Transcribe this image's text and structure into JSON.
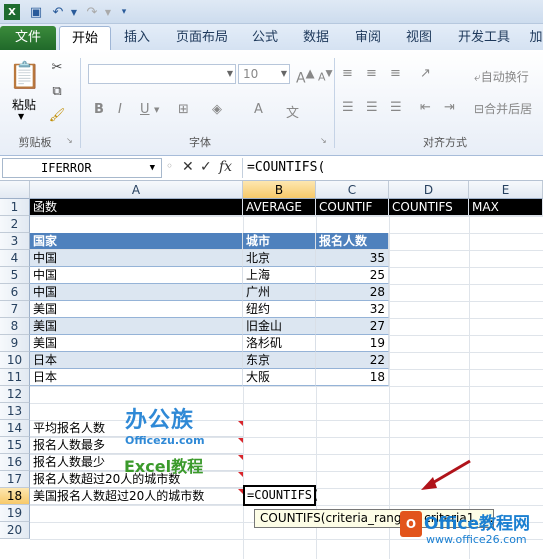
{
  "ribbon": {
    "tabs": [
      "文件",
      "开始",
      "插入",
      "页面布局",
      "公式",
      "数据",
      "审阅",
      "视图",
      "开发工具",
      "加"
    ],
    "paste_label": "粘贴",
    "groups": {
      "clipboard": "剪贴板",
      "font": "字体",
      "align": "对齐方式"
    },
    "font_size": "10",
    "wrap_text": "自动换行",
    "merge_center": "合并后居",
    "bold": "B",
    "italic": "I",
    "underline": "U"
  },
  "formula_bar": {
    "name_box": "IFERROR",
    "fx": "fx",
    "formula": "=COUNTIFS("
  },
  "columns": [
    "A",
    "B",
    "C",
    "D",
    "E"
  ],
  "rows": [
    "1",
    "2",
    "3",
    "4",
    "5",
    "6",
    "7",
    "8",
    "9",
    "10",
    "11",
    "12",
    "13",
    "14",
    "15",
    "16",
    "17",
    "18",
    "19",
    "20"
  ],
  "sheet": {
    "row1": [
      "函数",
      "AVERAGE",
      "COUNTIF",
      "COUNTIFS",
      "MAX"
    ],
    "table_header": [
      "国家",
      "城市",
      "报名人数"
    ],
    "table_rows": [
      [
        "中国",
        "北京",
        "35"
      ],
      [
        "中国",
        "上海",
        "25"
      ],
      [
        "中国",
        "广州",
        "28"
      ],
      [
        "美国",
        "纽约",
        "32"
      ],
      [
        "美国",
        "旧金山",
        "27"
      ],
      [
        "美国",
        "洛杉矶",
        "19"
      ],
      [
        "日本",
        "东京",
        "22"
      ],
      [
        "日本",
        "大阪",
        "18"
      ]
    ],
    "questions": [
      "平均报名人数",
      "报名人数最多",
      "报名人数最少",
      "报名人数超过20人的城市数",
      "美国报名人数超过20人的城市数"
    ],
    "active_cell_text": "=COUNTIFS(",
    "tooltip": "COUNTIFS(criteria_range1, criteria1, ..."
  },
  "watermarks": {
    "logo1_big": "办公族",
    "logo1_small": "Officezu.com",
    "logo2": "Excel教程",
    "logo3_big": "Office教程网",
    "logo3_small": "www.office26.com"
  }
}
